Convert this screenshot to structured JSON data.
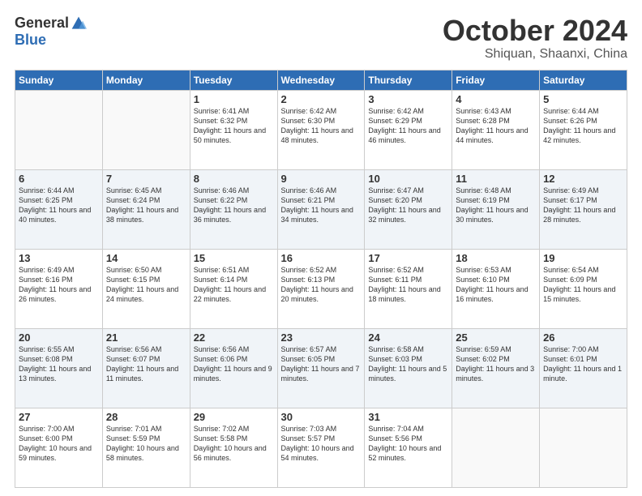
{
  "header": {
    "logo_general": "General",
    "logo_blue": "Blue",
    "month": "October 2024",
    "location": "Shiquan, Shaanxi, China"
  },
  "weekdays": [
    "Sunday",
    "Monday",
    "Tuesday",
    "Wednesday",
    "Thursday",
    "Friday",
    "Saturday"
  ],
  "weeks": [
    [
      {
        "day": "",
        "info": ""
      },
      {
        "day": "",
        "info": ""
      },
      {
        "day": "1",
        "info": "Sunrise: 6:41 AM\nSunset: 6:32 PM\nDaylight: 11 hours and 50 minutes."
      },
      {
        "day": "2",
        "info": "Sunrise: 6:42 AM\nSunset: 6:30 PM\nDaylight: 11 hours and 48 minutes."
      },
      {
        "day": "3",
        "info": "Sunrise: 6:42 AM\nSunset: 6:29 PM\nDaylight: 11 hours and 46 minutes."
      },
      {
        "day": "4",
        "info": "Sunrise: 6:43 AM\nSunset: 6:28 PM\nDaylight: 11 hours and 44 minutes."
      },
      {
        "day": "5",
        "info": "Sunrise: 6:44 AM\nSunset: 6:26 PM\nDaylight: 11 hours and 42 minutes."
      }
    ],
    [
      {
        "day": "6",
        "info": "Sunrise: 6:44 AM\nSunset: 6:25 PM\nDaylight: 11 hours and 40 minutes."
      },
      {
        "day": "7",
        "info": "Sunrise: 6:45 AM\nSunset: 6:24 PM\nDaylight: 11 hours and 38 minutes."
      },
      {
        "day": "8",
        "info": "Sunrise: 6:46 AM\nSunset: 6:22 PM\nDaylight: 11 hours and 36 minutes."
      },
      {
        "day": "9",
        "info": "Sunrise: 6:46 AM\nSunset: 6:21 PM\nDaylight: 11 hours and 34 minutes."
      },
      {
        "day": "10",
        "info": "Sunrise: 6:47 AM\nSunset: 6:20 PM\nDaylight: 11 hours and 32 minutes."
      },
      {
        "day": "11",
        "info": "Sunrise: 6:48 AM\nSunset: 6:19 PM\nDaylight: 11 hours and 30 minutes."
      },
      {
        "day": "12",
        "info": "Sunrise: 6:49 AM\nSunset: 6:17 PM\nDaylight: 11 hours and 28 minutes."
      }
    ],
    [
      {
        "day": "13",
        "info": "Sunrise: 6:49 AM\nSunset: 6:16 PM\nDaylight: 11 hours and 26 minutes."
      },
      {
        "day": "14",
        "info": "Sunrise: 6:50 AM\nSunset: 6:15 PM\nDaylight: 11 hours and 24 minutes."
      },
      {
        "day": "15",
        "info": "Sunrise: 6:51 AM\nSunset: 6:14 PM\nDaylight: 11 hours and 22 minutes."
      },
      {
        "day": "16",
        "info": "Sunrise: 6:52 AM\nSunset: 6:13 PM\nDaylight: 11 hours and 20 minutes."
      },
      {
        "day": "17",
        "info": "Sunrise: 6:52 AM\nSunset: 6:11 PM\nDaylight: 11 hours and 18 minutes."
      },
      {
        "day": "18",
        "info": "Sunrise: 6:53 AM\nSunset: 6:10 PM\nDaylight: 11 hours and 16 minutes."
      },
      {
        "day": "19",
        "info": "Sunrise: 6:54 AM\nSunset: 6:09 PM\nDaylight: 11 hours and 15 minutes."
      }
    ],
    [
      {
        "day": "20",
        "info": "Sunrise: 6:55 AM\nSunset: 6:08 PM\nDaylight: 11 hours and 13 minutes."
      },
      {
        "day": "21",
        "info": "Sunrise: 6:56 AM\nSunset: 6:07 PM\nDaylight: 11 hours and 11 minutes."
      },
      {
        "day": "22",
        "info": "Sunrise: 6:56 AM\nSunset: 6:06 PM\nDaylight: 11 hours and 9 minutes."
      },
      {
        "day": "23",
        "info": "Sunrise: 6:57 AM\nSunset: 6:05 PM\nDaylight: 11 hours and 7 minutes."
      },
      {
        "day": "24",
        "info": "Sunrise: 6:58 AM\nSunset: 6:03 PM\nDaylight: 11 hours and 5 minutes."
      },
      {
        "day": "25",
        "info": "Sunrise: 6:59 AM\nSunset: 6:02 PM\nDaylight: 11 hours and 3 minutes."
      },
      {
        "day": "26",
        "info": "Sunrise: 7:00 AM\nSunset: 6:01 PM\nDaylight: 11 hours and 1 minute."
      }
    ],
    [
      {
        "day": "27",
        "info": "Sunrise: 7:00 AM\nSunset: 6:00 PM\nDaylight: 10 hours and 59 minutes."
      },
      {
        "day": "28",
        "info": "Sunrise: 7:01 AM\nSunset: 5:59 PM\nDaylight: 10 hours and 58 minutes."
      },
      {
        "day": "29",
        "info": "Sunrise: 7:02 AM\nSunset: 5:58 PM\nDaylight: 10 hours and 56 minutes."
      },
      {
        "day": "30",
        "info": "Sunrise: 7:03 AM\nSunset: 5:57 PM\nDaylight: 10 hours and 54 minutes."
      },
      {
        "day": "31",
        "info": "Sunrise: 7:04 AM\nSunset: 5:56 PM\nDaylight: 10 hours and 52 minutes."
      },
      {
        "day": "",
        "info": ""
      },
      {
        "day": "",
        "info": ""
      }
    ]
  ]
}
